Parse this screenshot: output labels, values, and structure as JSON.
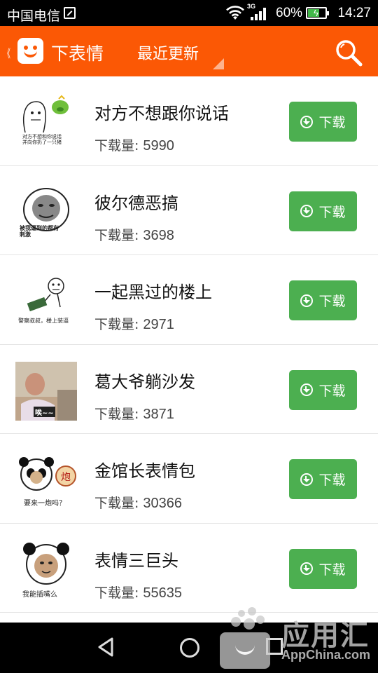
{
  "status_bar": {
    "carrier": "中国电信",
    "network_type": "3G",
    "battery": "60%",
    "time": "14:27"
  },
  "app_bar": {
    "back_glyph": "《",
    "title": "下表情",
    "sort_label": "最近更新"
  },
  "list": {
    "count_label": "下载量:",
    "download_label": "下载",
    "items": [
      {
        "name": "对方不想跟你说话",
        "count": "5990",
        "caption": "对方不想和你说话\n并向你扔了一只猪"
      },
      {
        "name": "彼尔德恶搞",
        "count": "3698",
        "caption": "被我逼到的都有\n刺激"
      },
      {
        "name": "一起黑过的楼上",
        "count": "2971",
        "caption": "警察叔叔，楼上装逼"
      },
      {
        "name": "葛大爷躺沙发",
        "count": "3871",
        "caption": "唉~~"
      },
      {
        "name": "金馆长表情包",
        "count": "30366",
        "caption": "要来一炮吗？"
      },
      {
        "name": "表情三巨头",
        "count": "55635",
        "caption": "我能插嘴么"
      }
    ]
  },
  "watermark": {
    "text": "应用汇",
    "sub": "AppChina.com"
  },
  "colors": {
    "app_bar": "#fb5805",
    "download_button": "#4caf50",
    "status_bar": "#000000",
    "nav_bar": "#000000"
  }
}
